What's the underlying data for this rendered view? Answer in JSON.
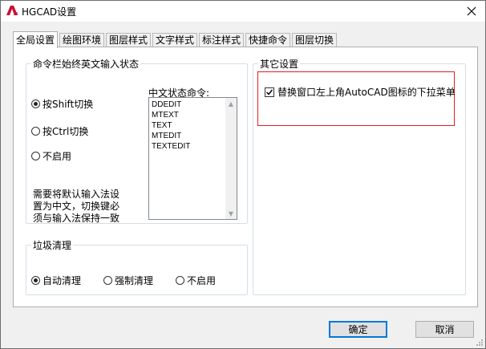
{
  "window": {
    "title": "HGCAD设置",
    "app_icon": "autocad-a-icon",
    "close_icon": "close-icon"
  },
  "tabs": [
    {
      "label": "全局设置",
      "active": true
    },
    {
      "label": "绘图环境",
      "active": false
    },
    {
      "label": "图层样式",
      "active": false
    },
    {
      "label": "文字样式",
      "active": false
    },
    {
      "label": "标注样式",
      "active": false
    },
    {
      "label": "快捷命令",
      "active": false
    },
    {
      "label": "图层切换",
      "active": false
    }
  ],
  "input_group": {
    "legend": "命令栏始终英文输入状态",
    "options": [
      {
        "label": "按Shift切换",
        "checked": true
      },
      {
        "label": "按Ctrl切换",
        "checked": false
      },
      {
        "label": "不启用",
        "checked": false
      }
    ],
    "list_label": "中文状态命令:",
    "list_items": [
      "DDEDIT",
      "MTEXT",
      "TEXT",
      "MTEDIT",
      "TEXTEDIT"
    ],
    "note": "需要将默认输入法设置为中文，切换键必须与输入法保持一致"
  },
  "cleanup_group": {
    "legend": "垃圾清理",
    "options": [
      {
        "label": "自动清理",
        "checked": true
      },
      {
        "label": "强制清理",
        "checked": false
      },
      {
        "label": "不启用",
        "checked": false
      }
    ]
  },
  "other_group": {
    "legend": "其它设置",
    "checkbox_label": "替换窗口左上角AutoCAD图标的下拉菜单",
    "checkbox_checked": true,
    "highlight_color": "#e01e24"
  },
  "buttons": {
    "ok": "确定",
    "cancel": "取消"
  }
}
